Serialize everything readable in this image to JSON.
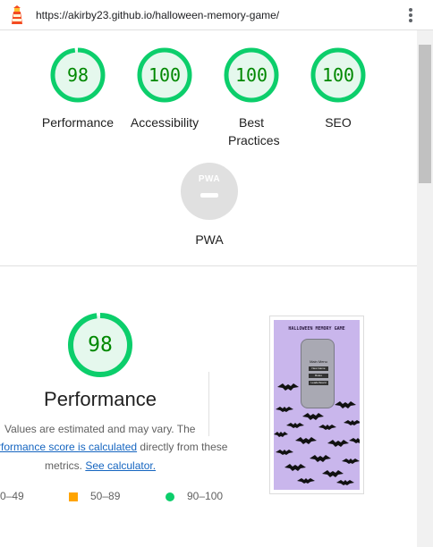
{
  "header": {
    "url": "https://akirby23.github.io/halloween-memory-game/",
    "logo_icon": "lighthouse-icon",
    "menu_icon": "kebab-menu-icon"
  },
  "summary": {
    "categories": [
      {
        "label": "Performance",
        "score": "98",
        "value": 98
      },
      {
        "label": "Accessibility",
        "score": "100",
        "value": 100
      },
      {
        "label": "Best Practices",
        "score": "100",
        "value": 100
      },
      {
        "label": "SEO",
        "score": "100",
        "value": 100
      }
    ],
    "pwa": {
      "badge": "PWA",
      "label": "PWA"
    }
  },
  "performance": {
    "score": "98",
    "value": 98,
    "title": "Performance",
    "line1": "Values are estimated and may vary. The",
    "link1": "rformance score is calculated",
    "line2_rest": " directly from these",
    "line3_prefix": "metrics. ",
    "link2": "See calculator."
  },
  "legend": {
    "fail": "0–49",
    "average": "50–89",
    "pass": "90–100"
  },
  "screenshot": {
    "title": "HALLOWEEN MEMORY GAME",
    "menu_title": "Main Menu",
    "buttons": [
      "New Game",
      "Rules",
      "Leaderboard"
    ]
  },
  "colors": {
    "pass": "#0cce6b",
    "pass_text": "#008800",
    "pass_bg": "#e5f8ed",
    "average": "#ffa400",
    "link": "#1565c0",
    "thumbnail_bg": "#c9b6ec"
  }
}
